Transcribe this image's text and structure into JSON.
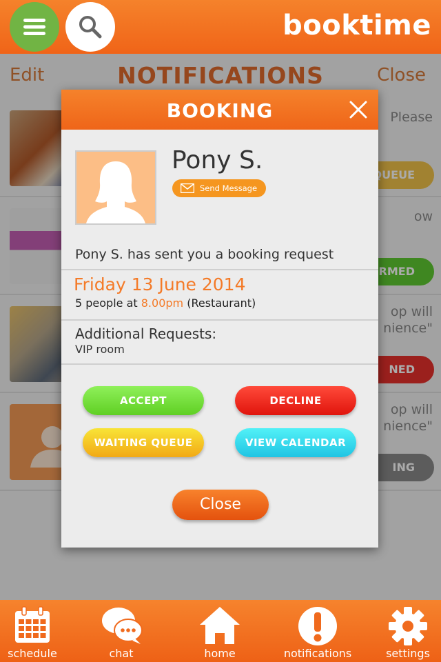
{
  "app": {
    "brand": "booktime"
  },
  "background": {
    "edit_label": "Edit",
    "title": "NOTIFICATIONS",
    "close_label": "Close",
    "rows": [
      {
        "text": "Please",
        "status": "QUEUE",
        "status_color": "#f1c24a"
      },
      {
        "text": "ow",
        "status": "RMED",
        "status_color": "#5ec932"
      },
      {
        "text": "op will\nnience\"",
        "status": "NED",
        "status_color": "#e8312c"
      },
      {
        "text": "op will\nnience\"",
        "status": "ING",
        "status_color": "#8a8a8a"
      }
    ]
  },
  "modal": {
    "title": "BOOKING",
    "name": "Pony S.",
    "send_message_label": "Send Message",
    "request_text": "Pony S. has sent you a booking request",
    "date": "Friday 13 June 2014",
    "people_prefix": "5 people at ",
    "time": "8.00pm",
    "venue": "(Restaurant)",
    "additional_label": "Additional Requests:",
    "additional_value": "VIP room",
    "buttons": {
      "accept": "ACCEPT",
      "decline": "DECLINE",
      "waiting_queue": "WAITING QUEUE",
      "view_calendar": "VIEW CALENDAR",
      "close": "Close"
    }
  },
  "nav": {
    "schedule": "schedule",
    "chat": "chat",
    "home": "home",
    "notifications": "notifications",
    "settings": "settings"
  },
  "colors": {
    "accent": "#f47a27",
    "menu_green": "#71b444"
  }
}
